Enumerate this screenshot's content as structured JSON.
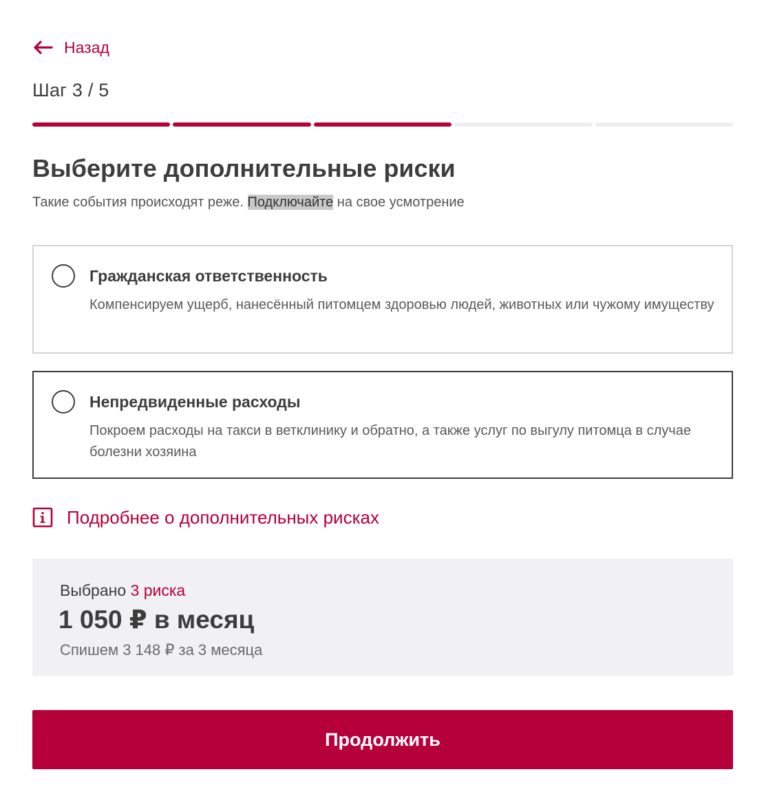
{
  "nav": {
    "back_label": "Назад"
  },
  "step": {
    "label": "Шаг 3 / 5",
    "current": 3,
    "total": 5
  },
  "header": {
    "title": "Выберите дополнительные риски",
    "subtitle_before": "Такие события происходят реже. ",
    "subtitle_highlight": "Подключайте",
    "subtitle_after": " на свое усмотрение"
  },
  "options": [
    {
      "title": "Гражданская ответственность",
      "description": "Компенсируем ущерб, нанесённый питомцем здоровью людей, животных или чужому имуществу",
      "selected": false
    },
    {
      "title": "Непредвиденные расходы",
      "description": "Покроем расходы на такси в ветклинику и обратно, а также услуг по выгулу питомца в случае болезни хозяина",
      "selected": false
    }
  ],
  "info_link": {
    "label": "Подробнее о дополнительных рисках"
  },
  "summary": {
    "selected_prefix": "Выбрано",
    "selected_count": "3 риска",
    "price": "1 050 ₽ в месяц",
    "charge_note": "Спишем 3 148 ₽ за 3 месяца"
  },
  "actions": {
    "continue_label": "Продолжить"
  },
  "colors": {
    "accent": "#b5003a",
    "text": "#3d3d3d",
    "summary_bg": "#f1f1f3",
    "progress_inactive": "#eeeef0"
  },
  "icons": {
    "back": "arrow-left-icon",
    "info": "info-icon",
    "radio": "radio-unchecked-icon"
  }
}
